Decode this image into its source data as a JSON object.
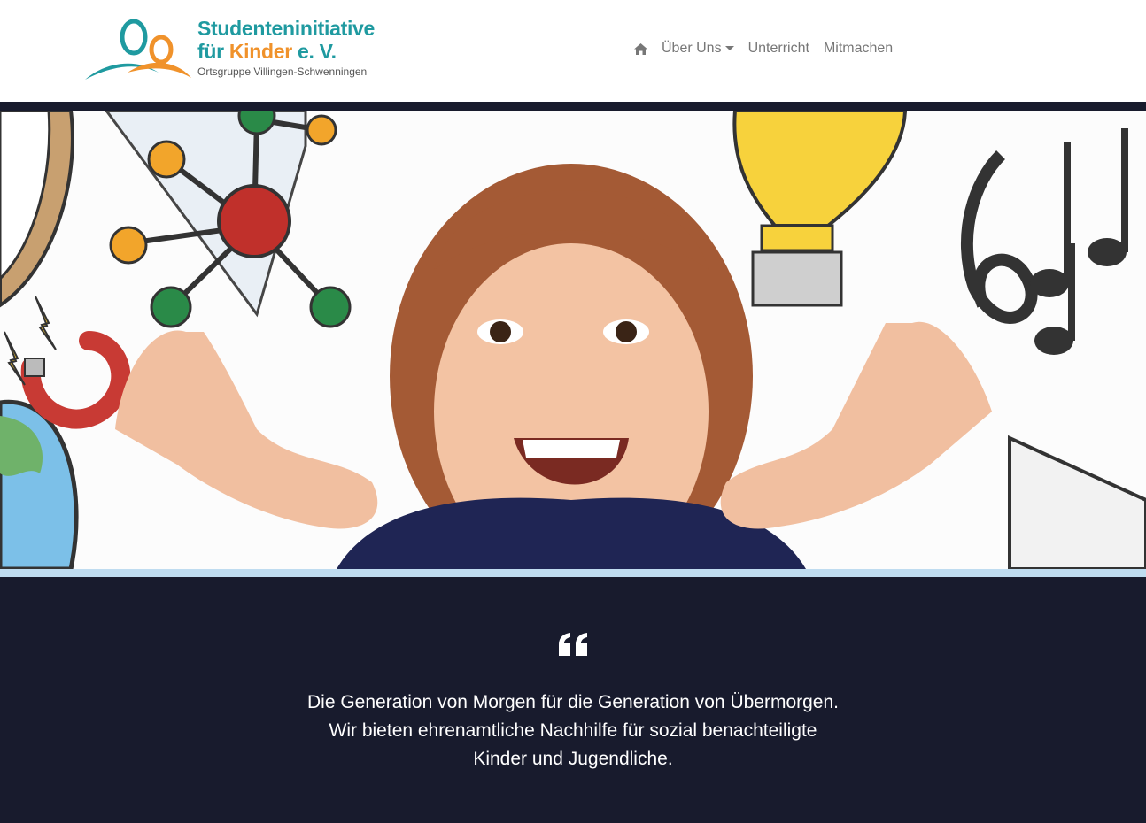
{
  "header": {
    "logo": {
      "line1": "Studenteninitiative",
      "line2_part1": "für ",
      "line2_part2": "Kinder",
      "line2_part3": " e. V.",
      "line3": "Ortsgruppe Villingen-Schwenningen"
    },
    "nav": {
      "home_icon": "home-icon",
      "items": [
        {
          "label": "Über Uns",
          "has_dropdown": true
        },
        {
          "label": "Unterricht"
        },
        {
          "label": "Mitmachen"
        }
      ]
    }
  },
  "hero": {
    "image_description_icon": "hero-image"
  },
  "quote": {
    "icon": "quote-icon",
    "text": "Die Generation von Morgen für die Generation von Übermorgen. Wir bieten ehrenamtliche Nachhilfe für sozial benachteiligte Kinder und Jugendliche."
  },
  "colors": {
    "teal": "#1f9aa0",
    "orange": "#f0922b",
    "dark_navy": "#181b2d",
    "light_blue": "#bfdcf0",
    "nav_gray": "#777777"
  }
}
